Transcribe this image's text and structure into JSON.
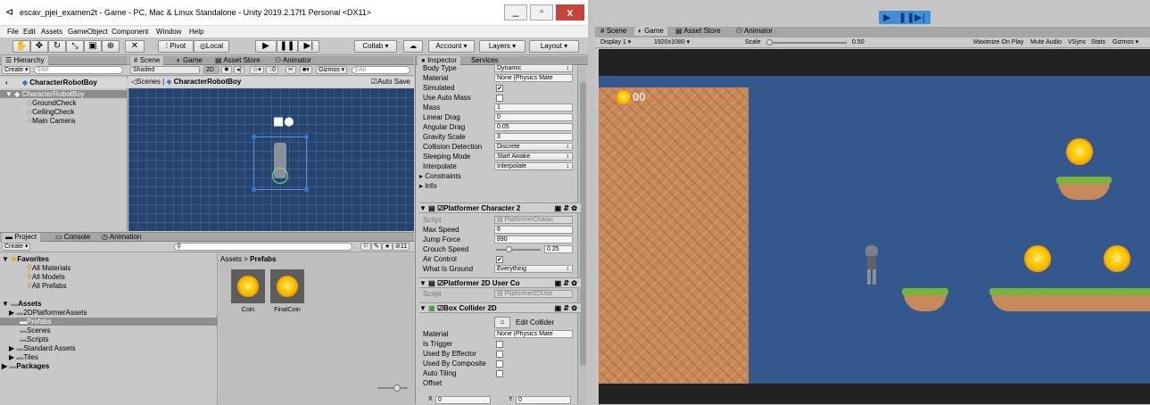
{
  "editor": {
    "title": "escav_pjei_examen2t - Game - PC, Mac & Linux Standalone - Unity 2019.2.17f1 Personal <DX11>",
    "menu": [
      "File",
      "Edit",
      "Assets",
      "GameObject",
      "Component",
      "Window",
      "Help"
    ],
    "toolbar": {
      "pivot": "Pivot",
      "local": "Local",
      "collab": "Collab",
      "account": "Account",
      "layers": "Layers",
      "layout": "Layout"
    },
    "hierarchy": {
      "tab": "Hierarchy",
      "create": "Create",
      "search": "All",
      "scene": "CharacterRobotBoy",
      "items": [
        "CharacterRobotBoy",
        "GroundCheck",
        "CeilingCheck",
        "Main Camera"
      ]
    },
    "scene_view": {
      "tabs": [
        "Scene",
        "Game",
        "Asset Store",
        "Animator"
      ],
      "shading": "Shaded",
      "mode": "2D",
      "gizmos": "Gizmos",
      "search": "All",
      "gizmo_count": "0",
      "breadcrumb_root": "Scenes",
      "breadcrumb_item": "CharacterRobotBoy",
      "auto_save": "Auto Save"
    },
    "project": {
      "tabs": [
        "Project",
        "Console",
        "Animation"
      ],
      "create": "Create",
      "badge": "11",
      "favorites": "Favorites",
      "favorite_items": [
        "All Materials",
        "All Models",
        "All Prefabs"
      ],
      "assets": "Assets",
      "asset_items": [
        "2DPlatformerAssets",
        "Prefabs",
        "Scenes",
        "Scripts",
        "Standard Assets",
        "Tiles"
      ],
      "packages": "Packages",
      "breadcrumb_root": "Assets",
      "breadcrumb_item": "Prefabs",
      "prefabs": [
        "Coin",
        "FinalCoin"
      ]
    },
    "inspector": {
      "tabs": [
        "Inspector",
        "Services"
      ],
      "rigidbody_rows": [
        {
          "label": "Body Type",
          "value": "Dynamic",
          "kind": "drop"
        },
        {
          "label": "Material",
          "value": "None (Physics Mate",
          "kind": "field"
        },
        {
          "label": "Simulated",
          "value": "✔",
          "kind": "check"
        },
        {
          "label": "Use Auto Mass",
          "value": "",
          "kind": "check"
        },
        {
          "label": "Mass",
          "value": "1",
          "kind": "field"
        },
        {
          "label": "Linear Drag",
          "value": "0",
          "kind": "field"
        },
        {
          "label": "Angular Drag",
          "value": "0.05",
          "kind": "field"
        },
        {
          "label": "Gravity Scale",
          "value": "3",
          "kind": "field"
        },
        {
          "label": "Collision Detection",
          "value": "Discrete",
          "kind": "drop"
        },
        {
          "label": "Sleeping Mode",
          "value": "Start Awake",
          "kind": "drop"
        },
        {
          "label": "Interpolate",
          "value": "Interpolate",
          "kind": "drop"
        },
        {
          "label": "Constraints",
          "value": "",
          "kind": "fold"
        },
        {
          "label": "Info",
          "value": "",
          "kind": "fold"
        }
      ],
      "comp_platformer": "Platformer Character 2",
      "platformer_rows": [
        {
          "label": "Script",
          "value": "PlatformerCharac",
          "kind": "script"
        },
        {
          "label": "Max Speed",
          "value": "6",
          "kind": "field"
        },
        {
          "label": "Jump Force",
          "value": "890",
          "kind": "field"
        },
        {
          "label": "Crouch Speed",
          "value": "0.25",
          "kind": "slider",
          "fill": 0.25
        },
        {
          "label": "Air Control",
          "value": "✔",
          "kind": "check"
        },
        {
          "label": "What Is Ground",
          "value": "Everything",
          "kind": "drop"
        }
      ],
      "comp_usercontrol": "Platformer 2D User Co",
      "usercontrol_script": "Platformer2DUse",
      "script_label": "Script",
      "comp_collider": "Box Collider 2D",
      "edit_collider": "Edit Collider",
      "collider_rows": [
        {
          "label": "Material",
          "value": "None (Physics Mate",
          "kind": "field"
        },
        {
          "label": "Is Trigger",
          "value": "",
          "kind": "check"
        },
        {
          "label": "Used By Effector",
          "value": "",
          "kind": "check"
        },
        {
          "label": "Used By Composite",
          "value": "",
          "kind": "check"
        },
        {
          "label": "Auto Tiling",
          "value": "",
          "kind": "check"
        },
        {
          "label": "Offset",
          "value": "",
          "kind": "plain"
        }
      ],
      "offset_x": "X",
      "offset_y": "Y",
      "offset_x_val": "0",
      "offset_y_val": "0"
    }
  },
  "game": {
    "tabs": [
      "Scene",
      "Game",
      "Asset Store",
      "Animator"
    ],
    "display": "Display 1",
    "resolution": "1920x1080",
    "scale_label": "Scale",
    "scale_value": "0.50",
    "options": [
      "Maximize On Play",
      "Mute Audio",
      "VSync",
      "Stats",
      "Gizmos"
    ],
    "coin_counter": "00",
    "colors": {
      "sky": "#34578e",
      "dirt": "#c8895a",
      "grass": "#78b43c",
      "play_blue": "#3f8fd8"
    }
  }
}
